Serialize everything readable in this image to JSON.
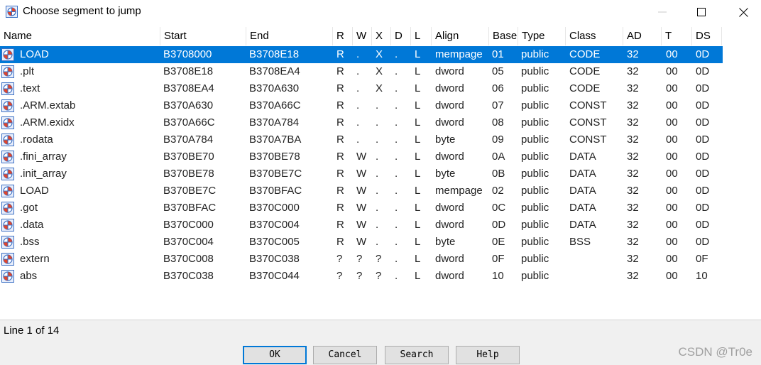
{
  "window": {
    "title": "Choose segment to jump"
  },
  "columns": [
    "Name",
    "Start",
    "End",
    "R",
    "W",
    "X",
    "D",
    "L",
    "Align",
    "Base",
    "Type",
    "Class",
    "AD",
    "T",
    "DS"
  ],
  "rows": [
    [
      "LOAD",
      "B3708000",
      "B3708E18",
      "R",
      ".",
      "X",
      ".",
      "L",
      "mempage",
      "01",
      "public",
      "CODE",
      "32",
      "00",
      "0D"
    ],
    [
      ".plt",
      "B3708E18",
      "B3708EA4",
      "R",
      ".",
      "X",
      ".",
      "L",
      "dword",
      "05",
      "public",
      "CODE",
      "32",
      "00",
      "0D"
    ],
    [
      ".text",
      "B3708EA4",
      "B370A630",
      "R",
      ".",
      "X",
      ".",
      "L",
      "dword",
      "06",
      "public",
      "CODE",
      "32",
      "00",
      "0D"
    ],
    [
      ".ARM.extab",
      "B370A630",
      "B370A66C",
      "R",
      ".",
      ".",
      ".",
      "L",
      "dword",
      "07",
      "public",
      "CONST",
      "32",
      "00",
      "0D"
    ],
    [
      ".ARM.exidx",
      "B370A66C",
      "B370A784",
      "R",
      ".",
      ".",
      ".",
      "L",
      "dword",
      "08",
      "public",
      "CONST",
      "32",
      "00",
      "0D"
    ],
    [
      ".rodata",
      "B370A784",
      "B370A7BA",
      "R",
      ".",
      ".",
      ".",
      "L",
      "byte",
      "09",
      "public",
      "CONST",
      "32",
      "00",
      "0D"
    ],
    [
      ".fini_array",
      "B370BE70",
      "B370BE78",
      "R",
      "W",
      ".",
      ".",
      "L",
      "dword",
      "0A",
      "public",
      "DATA",
      "32",
      "00",
      "0D"
    ],
    [
      ".init_array",
      "B370BE78",
      "B370BE7C",
      "R",
      "W",
      ".",
      ".",
      "L",
      "byte",
      "0B",
      "public",
      "DATA",
      "32",
      "00",
      "0D"
    ],
    [
      "LOAD",
      "B370BE7C",
      "B370BFAC",
      "R",
      "W",
      ".",
      ".",
      "L",
      "mempage",
      "02",
      "public",
      "DATA",
      "32",
      "00",
      "0D"
    ],
    [
      ".got",
      "B370BFAC",
      "B370C000",
      "R",
      "W",
      ".",
      ".",
      "L",
      "dword",
      "0C",
      "public",
      "DATA",
      "32",
      "00",
      "0D"
    ],
    [
      ".data",
      "B370C000",
      "B370C004",
      "R",
      "W",
      ".",
      ".",
      "L",
      "dword",
      "0D",
      "public",
      "DATA",
      "32",
      "00",
      "0D"
    ],
    [
      ".bss",
      "B370C004",
      "B370C005",
      "R",
      "W",
      ".",
      ".",
      "L",
      "byte",
      "0E",
      "public",
      "BSS",
      "32",
      "00",
      "0D"
    ],
    [
      "extern",
      "B370C008",
      "B370C038",
      "?",
      "?",
      "?",
      ".",
      "L",
      "dword",
      "0F",
      "public",
      "",
      "32",
      "00",
      "0F"
    ],
    [
      "abs",
      "B370C038",
      "B370C044",
      "?",
      "?",
      "?",
      ".",
      "L",
      "dword",
      "10",
      "public",
      "",
      "32",
      "00",
      "10"
    ]
  ],
  "selected_row": 0,
  "status": {
    "text": "Line 1 of 14"
  },
  "buttons": {
    "ok": "OK",
    "cancel": "Cancel",
    "search": "Search",
    "help": "Help"
  },
  "watermark": "CSDN @Tr0e",
  "colors": {
    "selection": "#0078d7",
    "default_button_border": "#0078d7"
  },
  "icons": {
    "app": "ida-icon",
    "segment": "segment-icon"
  }
}
